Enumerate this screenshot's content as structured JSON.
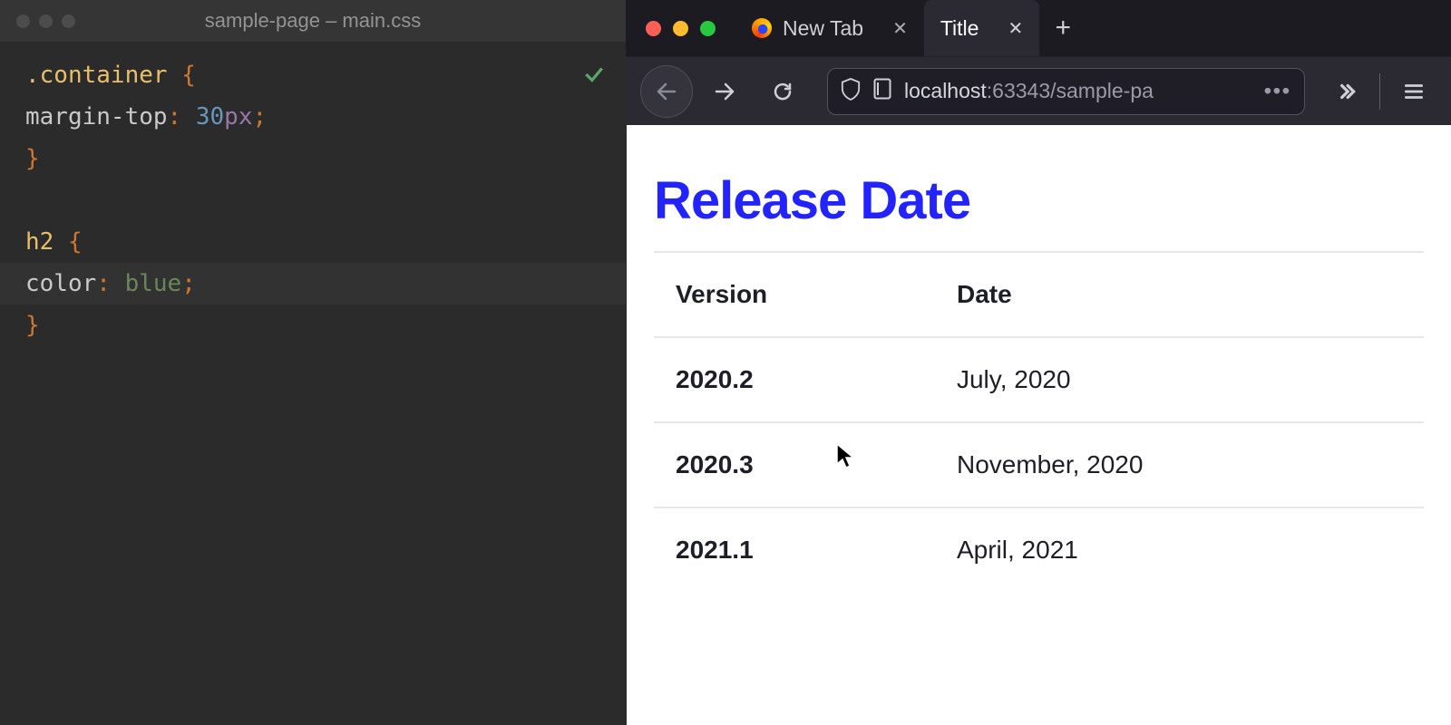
{
  "editor": {
    "title": "sample-page – main.css",
    "code": {
      "l1_selector": ".container",
      "l1_open": " {",
      "l2_indent": "    ",
      "l2_prop": "margin-top",
      "l2_colon": ": ",
      "l2_num": "30",
      "l2_unit": "px",
      "l2_semi": ";",
      "l3_close": "}",
      "l5_selector": "h2",
      "l5_open": " {",
      "l6_indent": "    ",
      "l6_prop": "color",
      "l6_colon": ": ",
      "l6_value": "blue",
      "l6_semi": ";",
      "l7_close": "}"
    },
    "status_ok": "✓"
  },
  "browser": {
    "tabs": [
      {
        "label": "New Tab",
        "active": false
      },
      {
        "label": "Title",
        "active": true
      }
    ],
    "url_host": "localhost",
    "url_rest": ":63343/sample-pa",
    "url_ellipsis": "•••"
  },
  "page": {
    "heading": "Release Date",
    "headers": {
      "version": "Version",
      "date": "Date"
    },
    "rows": [
      {
        "version": "2020.2",
        "date": "July, 2020"
      },
      {
        "version": "2020.3",
        "date": "November, 2020"
      },
      {
        "version": "2021.1",
        "date": "April, 2021"
      }
    ]
  }
}
